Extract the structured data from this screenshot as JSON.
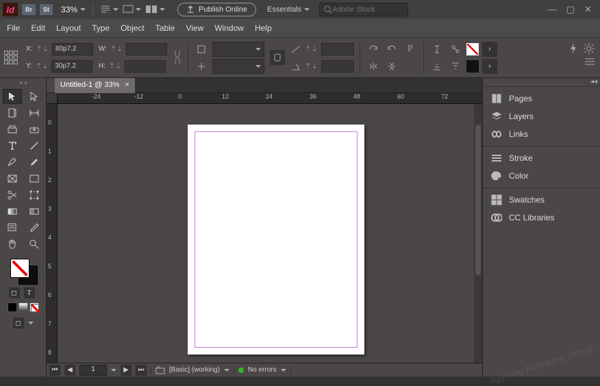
{
  "appbar": {
    "logo_text": "Id",
    "br_label": "Br",
    "st_label": "St",
    "zoom": "33%",
    "publish_label": "Publish Online",
    "workspace": "Essentials",
    "stock_placeholder": "Adobe Stock"
  },
  "menu": [
    "File",
    "Edit",
    "Layout",
    "Type",
    "Object",
    "Table",
    "View",
    "Window",
    "Help"
  ],
  "controls": {
    "x_label": "X:",
    "x_val": "80p7.2",
    "y_label": "Y:",
    "y_val": "30p7.2",
    "w_label": "W:",
    "h_label": "H:"
  },
  "document": {
    "tab_title": "Untitled-1 @ 33%",
    "ruler_h": [
      "-24",
      "-12",
      "0",
      "12",
      "24",
      "36",
      "48",
      "60",
      "72"
    ],
    "ruler_v": [
      "0",
      "1",
      "2",
      "3",
      "4",
      "5",
      "6",
      "7",
      "8"
    ]
  },
  "status": {
    "page": "1",
    "profile": "[Basic] (working)",
    "errors": "No errors"
  },
  "panels": {
    "group1": [
      {
        "key": "pages",
        "label": "Pages"
      },
      {
        "key": "layers",
        "label": "Layers"
      },
      {
        "key": "links",
        "label": "Links"
      }
    ],
    "group2": [
      {
        "key": "stroke",
        "label": "Stroke"
      },
      {
        "key": "color",
        "label": "Color"
      }
    ],
    "group3": [
      {
        "key": "swatches",
        "label": "Swatches"
      },
      {
        "key": "cclibs",
        "label": "CC Libraries"
      }
    ]
  }
}
